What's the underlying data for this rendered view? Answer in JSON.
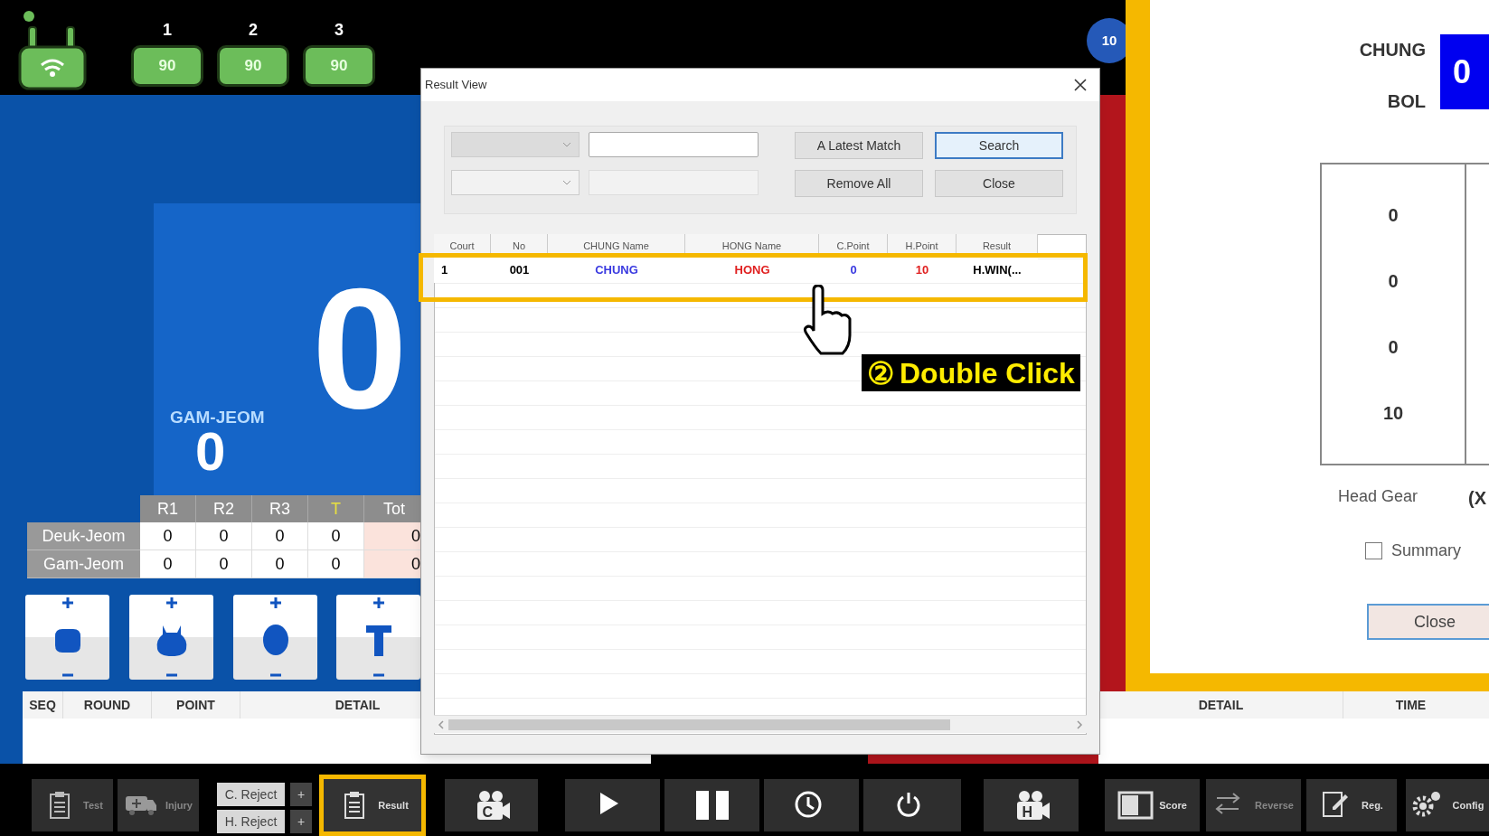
{
  "devices": [
    {
      "label": "1",
      "value": "90"
    },
    {
      "label": "2",
      "value": "90"
    },
    {
      "label": "3",
      "value": "90"
    }
  ],
  "badge": "10",
  "scoreboard": {
    "main_score": "0",
    "gam_jeom_label": "GAM-JEOM",
    "gam_jeom_value": "0",
    "columns": [
      "R1",
      "R2",
      "R3",
      "T",
      "Tot"
    ],
    "rows": [
      {
        "label": "Deuk-Jeom",
        "values": [
          "0",
          "0",
          "0",
          "0",
          "0"
        ]
      },
      {
        "label": "Gam-Jeom",
        "values": [
          "0",
          "0",
          "0",
          "0",
          "0"
        ]
      }
    ],
    "log_columns": [
      "SEQ",
      "ROUND",
      "POINT",
      "DETAIL"
    ]
  },
  "result_view": {
    "title": "Result View",
    "buttons": [
      "A Latest Match",
      "Search",
      "Remove All",
      "Close"
    ],
    "columns": [
      "Court",
      "No",
      "CHUNG Name",
      "HONG Name",
      "C.Point",
      "H.Point",
      "Result"
    ],
    "rows": [
      {
        "cells": [
          "1",
          "001",
          "CHUNG",
          "HONG",
          "0",
          "10",
          "H.WIN(..."
        ],
        "selected": true
      }
    ]
  },
  "callout": {
    "number": "②",
    "text": "Double Click"
  },
  "detail_panel": {
    "name_lines": [
      "CHUNG",
      "BOL"
    ],
    "score": "0",
    "values": [
      "0",
      "0",
      "0",
      "10"
    ],
    "head_gear_label": "Head Gear",
    "head_gear_value": "(X",
    "summary": {
      "label": "Summary",
      "checked": false
    },
    "close": "Close"
  },
  "right_log_columns": [
    "DETAIL",
    "TIME"
  ],
  "toolbar": [
    {
      "kind": "clipboard",
      "label": "Test",
      "disabled": true
    },
    {
      "kind": "ambulance",
      "label": "Injury",
      "disabled": true
    },
    {
      "kind": "reject",
      "labels": [
        "C. Reject",
        "H. Reject"
      ],
      "plus": [
        "+",
        "+"
      ]
    },
    {
      "kind": "result",
      "label": "Result",
      "selected": true
    },
    {
      "kind": "camera",
      "label": "C"
    },
    {
      "kind": "play"
    },
    {
      "kind": "pause"
    },
    {
      "kind": "timer"
    },
    {
      "kind": "power"
    },
    {
      "kind": "camera",
      "label": "H"
    },
    {
      "kind": "score",
      "label": "Score"
    },
    {
      "kind": "reverse",
      "label": "Reverse",
      "disabled": true
    },
    {
      "kind": "reg",
      "label": "Reg."
    },
    {
      "kind": "config",
      "label": "Config"
    }
  ]
}
